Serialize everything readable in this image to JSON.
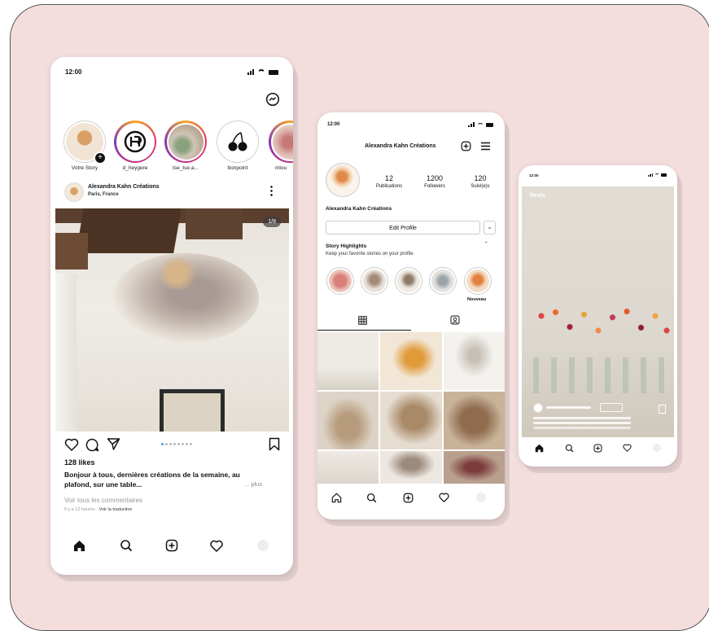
{
  "feed": {
    "time": "12:00",
    "stories": [
      {
        "label": "Votre Story"
      },
      {
        "label": "d_heygere"
      },
      {
        "label": "tse_tse.a..."
      },
      {
        "label": "bonpoint"
      },
      {
        "label": "mlou"
      }
    ],
    "post": {
      "account": "Alexandra Kahn Créations",
      "location": "Paris, France",
      "counter": "1/8",
      "likes": "128 likes",
      "caption": "Bonjour à tous, dernières créations de la semaine, au plafond, sur une table...",
      "more": "... plus",
      "comments": "Voir tous les commentaires",
      "time_ago": "Il y a 12 heures",
      "translate": "Voir la traduction"
    }
  },
  "profile": {
    "time": "12:00",
    "title": "Alexandra Kahn Créations",
    "stats": [
      {
        "value": "12",
        "label": "Publications"
      },
      {
        "value": "1200",
        "label": "Followers"
      },
      {
        "value": "120",
        "label": "Suivi(e)s"
      }
    ],
    "name": "Alexandra Kahn Créations",
    "edit_label": "Edit Profile",
    "highlights_title": "Story Highlights",
    "highlights_sub": "Keep your favorite stories on your profile",
    "new_label": "Nouveau"
  },
  "reels": {
    "time": "12:00",
    "title": "Reels"
  },
  "colors": {
    "background": "#f3dedd",
    "accent": "#e1306c"
  }
}
